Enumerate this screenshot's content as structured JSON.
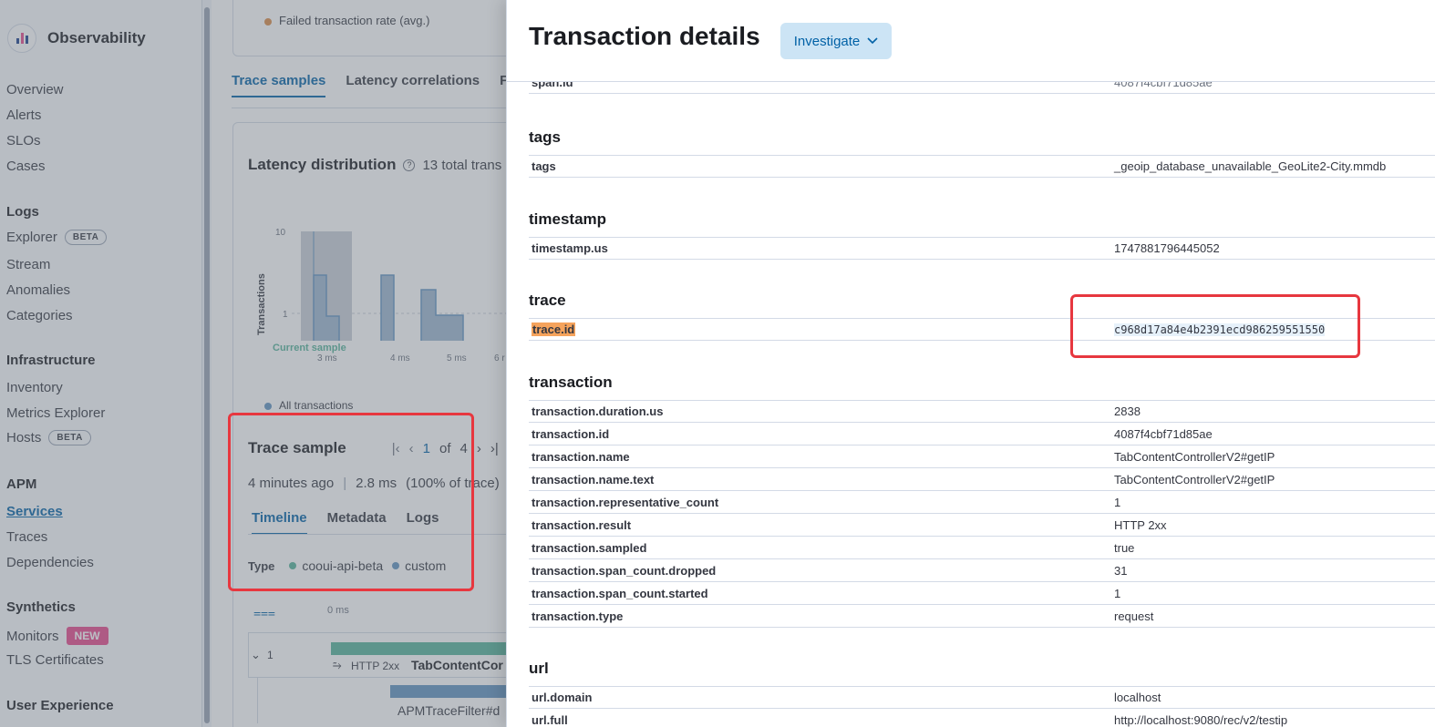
{
  "sidebar": {
    "brand": "Observability",
    "items": [
      {
        "label": "Overview",
        "top": 0
      },
      {
        "label": "Alerts"
      },
      {
        "label": "SLOs"
      },
      {
        "label": "Cases"
      }
    ],
    "logs": {
      "title": "Logs",
      "explorer": "Explorer",
      "explorer_badge": "BETA",
      "stream": "Stream",
      "anomalies": "Anomalies",
      "categories": "Categories"
    },
    "infra": {
      "title": "Infrastructure",
      "inventory": "Inventory",
      "metrics": "Metrics Explorer",
      "hosts": "Hosts",
      "hosts_badge": "BETA"
    },
    "apm": {
      "title": "APM",
      "services": "Services",
      "traces": "Traces",
      "dependencies": "Dependencies"
    },
    "synthetics": {
      "title": "Synthetics",
      "monitors": "Monitors",
      "monitors_badge": "NEW",
      "tls": "TLS Certificates"
    },
    "ux": {
      "title": "User Experience"
    }
  },
  "main": {
    "failed_rate": "Failed transaction rate (avg.)",
    "tabs": [
      "Trace samples",
      "Latency correlations",
      "F"
    ],
    "latency_title": "Latency distribution",
    "total_trans": "13 total trans",
    "chart": {
      "ylabel": "Transactions",
      "yticks": [
        "10",
        "1"
      ],
      "xticks": [
        "3 ms",
        "4 ms",
        "5 ms",
        "6 r"
      ],
      "current_sample": "Current sample",
      "legend": "All transactions"
    },
    "trace_sample": {
      "title": "Trace sample",
      "page": "1",
      "of": "of",
      "total": "4",
      "meta": "4 minutes ago",
      "duration": "2.8 ms",
      "pct": "(100% of trace)",
      "tabs": [
        "Timeline",
        "Metadata",
        "Logs"
      ],
      "type_label": "Type",
      "types": [
        {
          "name": "cooui-api-beta",
          "color": "#54b399"
        },
        {
          "name": "custom",
          "color": "#6092c0"
        }
      ]
    },
    "timeline": {
      "zero": "0 ms",
      "row_num": "1",
      "status": "HTTP 2xx",
      "name": "TabContentCor",
      "child": "APMTraceFilter#d"
    }
  },
  "flyout": {
    "title": "Transaction details",
    "investigate": "Investigate",
    "partial_top": {
      "key": "span.id",
      "value": "4087f4cbf71d85ae"
    },
    "groups": {
      "tags": {
        "title": "tags",
        "rows": [
          {
            "k": "tags",
            "v": "_geoip_database_unavailable_GeoLite2-City.mmdb"
          }
        ]
      },
      "timestamp": {
        "title": "timestamp",
        "rows": [
          {
            "k": "timestamp.us",
            "v": "1747881796445052"
          }
        ]
      },
      "trace": {
        "title": "trace",
        "rows": [
          {
            "k": "trace.id",
            "v": "c968d17a84e4b2391ecd986259551550"
          }
        ]
      },
      "transaction": {
        "title": "transaction",
        "rows": [
          {
            "k": "transaction.duration.us",
            "v": "2838"
          },
          {
            "k": "transaction.id",
            "v": "4087f4cbf71d85ae"
          },
          {
            "k": "transaction.name",
            "v": "TabContentControllerV2#getIP"
          },
          {
            "k": "transaction.name.text",
            "v": "TabContentControllerV2#getIP"
          },
          {
            "k": "transaction.representative_count",
            "v": "1"
          },
          {
            "k": "transaction.result",
            "v": "HTTP 2xx"
          },
          {
            "k": "transaction.sampled",
            "v": "true"
          },
          {
            "k": "transaction.span_count.dropped",
            "v": "31"
          },
          {
            "k": "transaction.span_count.started",
            "v": "1"
          },
          {
            "k": "transaction.type",
            "v": "request"
          }
        ]
      },
      "url": {
        "title": "url",
        "rows": [
          {
            "k": "url.domain",
            "v": "localhost"
          },
          {
            "k": "url.full",
            "v": "http://localhost:9080/rec/v2/testip"
          }
        ]
      }
    }
  }
}
